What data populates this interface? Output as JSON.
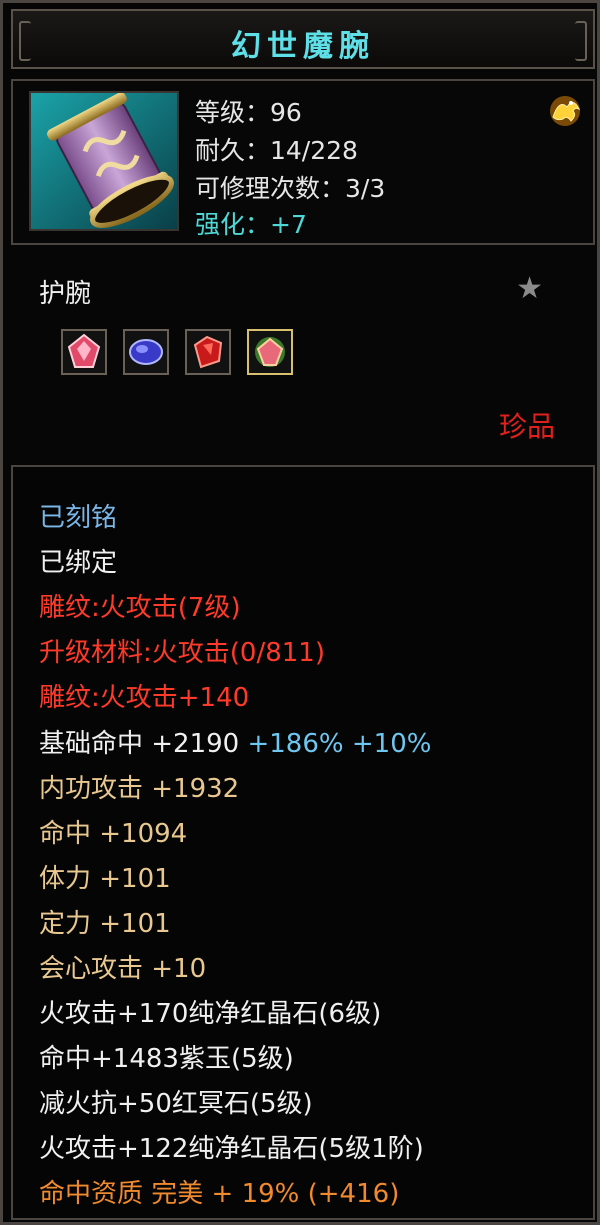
{
  "item": {
    "name": "幻世魔腕",
    "level": "等级：96",
    "durability": "耐久：14/228",
    "repair_count": "可修理次数：3/3",
    "enhance": "强化：+7",
    "type": "护腕",
    "rarity": "珍品",
    "favorite_icon": "star-icon",
    "badge_icon": "golden-dragon-icon",
    "gems": [
      "red-crystal-icon",
      "purple-jade-icon",
      "red-gem-icon",
      "red-crystal-icon"
    ]
  },
  "properties": [
    {
      "text": "已刻铭"
    },
    {
      "text": "已绑定"
    },
    {
      "text": "雕纹:火攻击(7级)"
    },
    {
      "text": "升级材料:火攻击(0/811)"
    },
    {
      "text": "雕纹:火攻击+140"
    },
    {
      "label": "基础命中  +2190",
      "extra1": " +186%",
      "extra2": " +10%"
    },
    {
      "text": "内功攻击  +1932"
    },
    {
      "text": "命中  +1094"
    },
    {
      "text": "体力  +101"
    },
    {
      "text": "定力  +101"
    },
    {
      "text": "会心攻击  +10"
    },
    {
      "text": "火攻击+170纯净红晶石(6级)"
    },
    {
      "text": "命中+1483紫玉(5级)"
    },
    {
      "text": "减火抗+50红冥石(5级)"
    },
    {
      "text": "火攻击+122纯净红晶石(5级1阶)"
    },
    {
      "text": "命中资质  完美  + 19% (+416)"
    }
  ],
  "colors": {
    "title": "#5fe0e8",
    "enhance": "#4fd7d6",
    "rarity": "#e0201c",
    "engraved": "#7ab6e6",
    "carving": "#ff3a2a",
    "attribute": "#e8c890",
    "bonus": "#6ec7f0",
    "quality": "#f08a2e"
  }
}
